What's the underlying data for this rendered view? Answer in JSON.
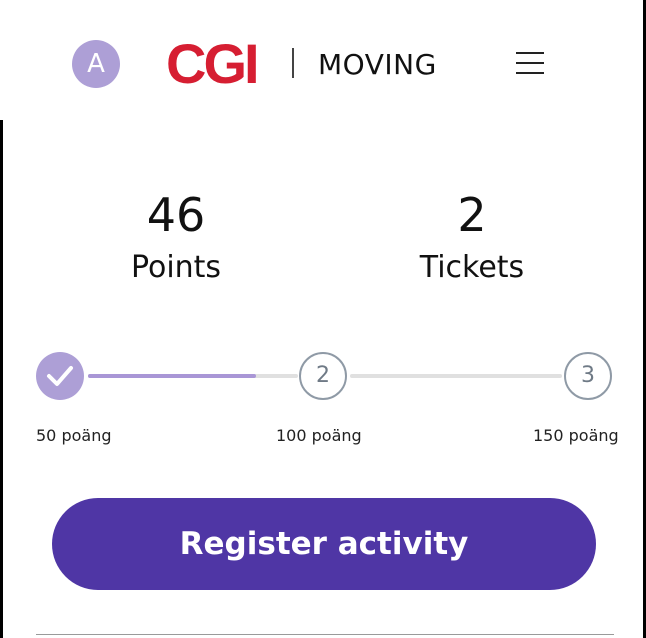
{
  "header": {
    "avatar_initial": "A",
    "logo_text": "CGI",
    "app_name": "MOVING",
    "menu_icon": "hamburger-menu-icon"
  },
  "stats": {
    "points": {
      "value": "46",
      "label": "Points"
    },
    "tickets": {
      "value": "2",
      "label": "Tickets"
    }
  },
  "progress": {
    "fill_fraction_between_step1_and_step2": 0.8,
    "steps": [
      {
        "state": "completed",
        "icon": "checkmark-icon",
        "label": "50 poäng"
      },
      {
        "state": "pending",
        "number": "2",
        "label": "100 poäng"
      },
      {
        "state": "pending",
        "number": "3",
        "label": "150 poäng"
      }
    ]
  },
  "cta": {
    "label": "Register activity"
  },
  "colors": {
    "accent": "#4f36a5",
    "accent_light": "#ad9fd6",
    "brand_red": "#d61e32",
    "track_gray": "#e0e0e0"
  }
}
